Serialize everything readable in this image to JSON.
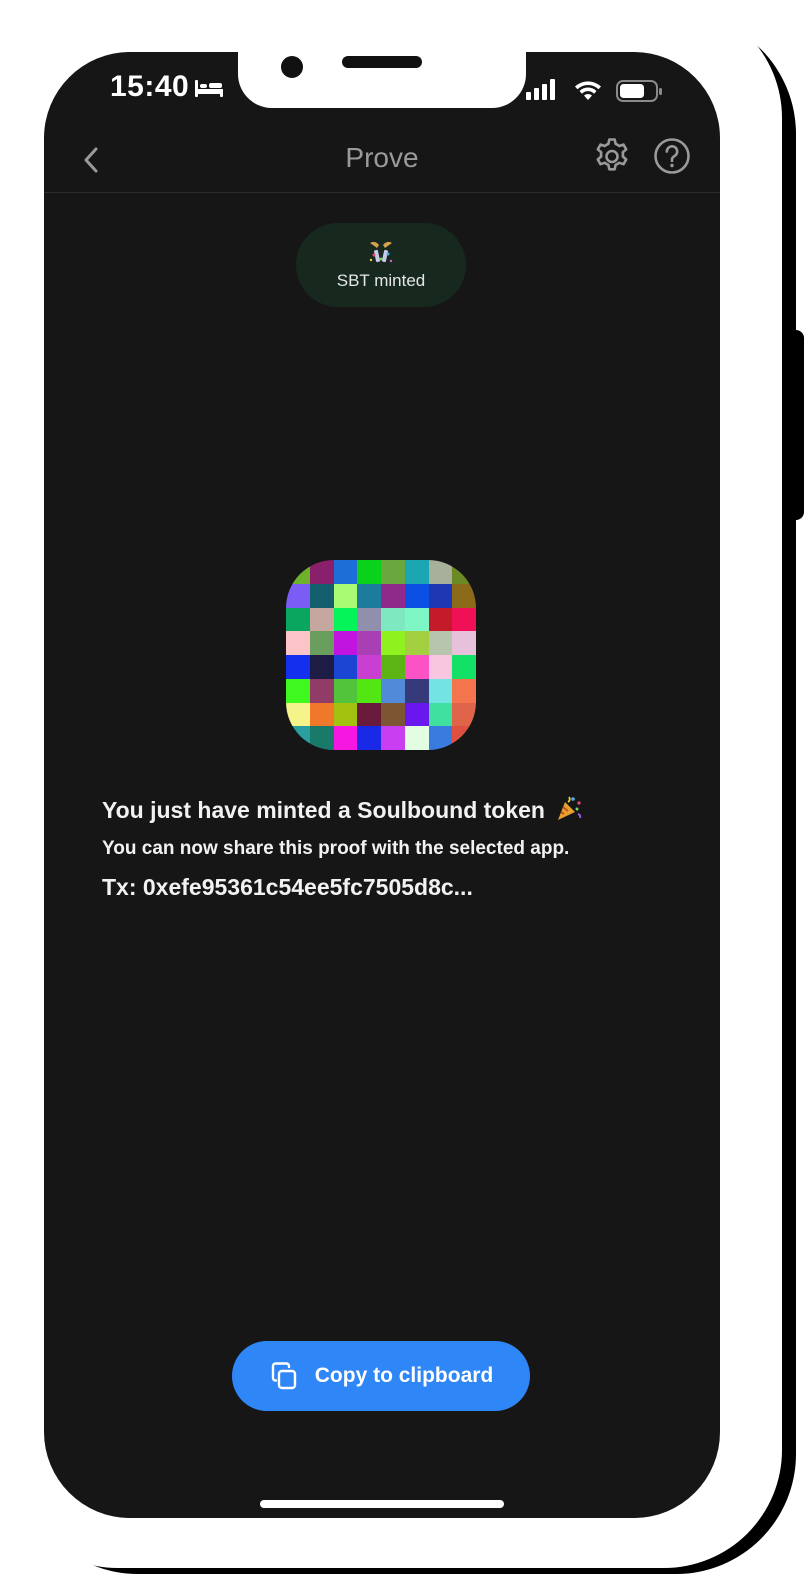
{
  "status_bar": {
    "time": "15:40",
    "icons": [
      "bed-icon",
      "signal-icon",
      "wifi-icon",
      "battery-icon"
    ]
  },
  "header": {
    "title": "Prove",
    "back_icon": "chevron-left-icon",
    "settings_icon": "gear-icon",
    "help_icon": "question-circle-icon"
  },
  "status_pill": {
    "icon": "celebration-icon",
    "label": "SBT minted",
    "background": "#17281f"
  },
  "token_image": {
    "icon": "identicon-pixel-grid",
    "grid": [
      [
        "#6eb12a",
        "#8a1f6b",
        "#1d6ed6",
        "#0ad11a",
        "#6aa83e",
        "#1aa7b3",
        "#a7b09a",
        "#6b8a24"
      ],
      [
        "#7b5cf5",
        "#145f6e",
        "#a9fb74",
        "#1d7b9b",
        "#8d2a8a",
        "#0b4fe5",
        "#1e38b3",
        "#8b6a1a"
      ],
      [
        "#0aa55f",
        "#c5a79f",
        "#04f45a",
        "#9090ad",
        "#7ee8c0",
        "#7ff6c6",
        "#c41a2a",
        "#f01055"
      ],
      [
        "#fbc5c7",
        "#6a9e5e",
        "#c214e0",
        "#a83fb4",
        "#8ff21e",
        "#a3cf41",
        "#b7c4ae",
        "#e7c0db"
      ],
      [
        "#1430ee",
        "#1c1c44",
        "#1b46d4",
        "#c83fd2",
        "#5cb415",
        "#fb52c5",
        "#f9c6e0",
        "#13e167"
      ],
      [
        "#3ef81e",
        "#913b67",
        "#51c43c",
        "#52e613",
        "#508ad9",
        "#363a7a",
        "#73e3e4",
        "#f4744d"
      ],
      [
        "#f4f48a",
        "#f0782a",
        "#a2c20f",
        "#6a1b3b",
        "#7c5533",
        "#6a16ee",
        "#40e0a0",
        "#e0644a"
      ],
      [
        "#2a9ea0",
        "#1a7a6a",
        "#f617e2",
        "#1a28e8",
        "#c93ef0",
        "#e2fde2",
        "#3a7be0",
        "#e05040"
      ]
    ]
  },
  "message": {
    "title": "You just have minted a Soulbound token",
    "title_icon": "party-popper-icon",
    "subtitle": "You can now share this proof with the selected app.",
    "tx": "Tx: 0xefe95361c54ee5fc7505d8c..."
  },
  "copy_button": {
    "label": "Copy to clipboard",
    "icon": "copy-icon",
    "color": "#2f86f6"
  },
  "theme": {
    "screen_background": "#161616",
    "header_title_color": "#9a9a9a"
  }
}
